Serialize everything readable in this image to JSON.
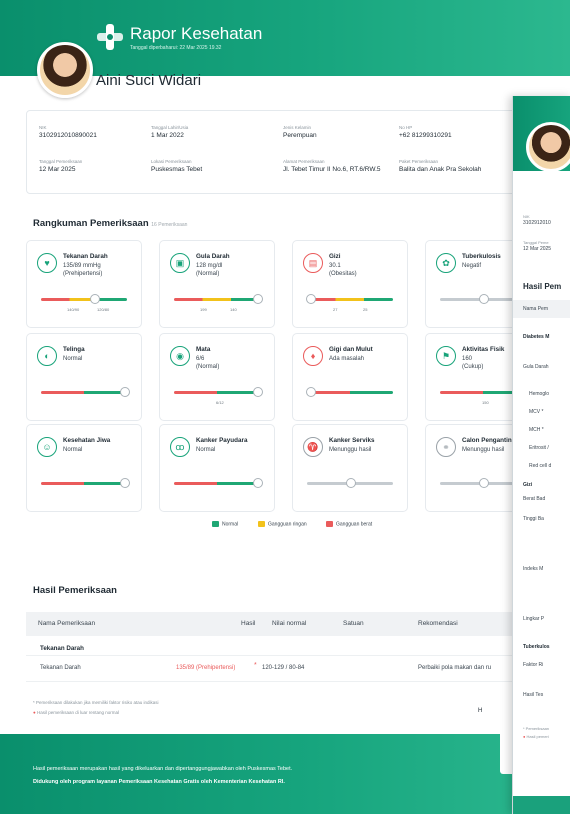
{
  "header": {
    "brand": "Rapor Kesehatan",
    "updated": "Tanggal diperbaharui: 22 Mar 2025 19.32"
  },
  "patient": {
    "name": "Aini Suci Widari"
  },
  "info": {
    "nik_label": "NIK",
    "nik": "3102912010890021",
    "dob_label": "Tanggal Lahir/Usia",
    "dob": "1 Mar 2022",
    "sex_label": "Jenis Kelamin",
    "sex": "Perempuan",
    "phone_label": "No HP",
    "phone": "+62 81299310291",
    "exam_date_label": "Tanggal Pemeriksaan",
    "exam_date": "12 Mar 2025",
    "location_label": "Lokasi Pemeriksaan",
    "location": "Puskesmas Tebet",
    "address_label": "Alamat Pemeriksaan",
    "address": "Jl. Tebet Timur II No.6, RT.6/RW.5",
    "package_label": "Paket Pemeriksaan",
    "package": "Balita dan Anak Pra Sekolah"
  },
  "summary": {
    "title": "Rangkuman Pemeriksaan",
    "count": "16 Pemeriksaan",
    "cards": [
      {
        "title": "Tekanan Darah",
        "l1": "135/89 mmHg",
        "l2": "(Prehipertensi)",
        "t1": "140/90",
        "t2": "120/80",
        "level": 0.62,
        "icon": "blood-pressure-icon",
        "glyph": "♥"
      },
      {
        "title": "Gula Darah",
        "l1": "128 mg/dl",
        "l2": "(Normal)",
        "t1": "199",
        "t2": "140",
        "level": 0.96,
        "icon": "glucose-meter-icon",
        "glyph": "▣"
      },
      {
        "title": "Gizi",
        "l1": "30.1",
        "l2": "(Obesitas)",
        "t1": "27",
        "t2": "25",
        "level": 0.03,
        "icon": "nutrition-icon",
        "glyph": "▤"
      },
      {
        "title": "Tuberkulosis",
        "l1": "Negatif",
        "l2": "",
        "t1": "",
        "t2": "",
        "level": 0.5,
        "icon": "lungs-icon",
        "glyph": "✿"
      },
      {
        "title": "Telinga",
        "l1": "Normal",
        "l2": "",
        "t1": "",
        "t2": "",
        "level": 0.96,
        "icon": "ear-icon",
        "glyph": "◐"
      },
      {
        "title": "Mata",
        "l1": "6/6",
        "l2": "(Normal)",
        "t1": "6/12",
        "t2": "",
        "level": 0.96,
        "icon": "eye-icon",
        "glyph": "◉"
      },
      {
        "title": "Gigi dan Mulut",
        "l1": "Ada masalah",
        "l2": "",
        "t1": "",
        "t2": "",
        "level": 0.03,
        "icon": "tooth-icon",
        "glyph": "♦"
      },
      {
        "title": "Aktivitas Fisik",
        "l1": "160",
        "l2": "(Cukup)",
        "t1": "150",
        "t2": "",
        "level": 0.96,
        "icon": "running-icon",
        "glyph": "⚑"
      },
      {
        "title": "Kesehatan Jiwa",
        "l1": "Normal",
        "l2": "",
        "t1": "",
        "t2": "",
        "level": 0.96,
        "icon": "mind-icon",
        "glyph": "☺"
      },
      {
        "title": "Kanker Payudara",
        "l1": "Normal",
        "l2": "",
        "t1": "",
        "t2": "",
        "level": 0.96,
        "icon": "ribbon-icon",
        "glyph": "ꝏ"
      },
      {
        "title": "Kanker Serviks",
        "l1": "Menunggu hasil",
        "l2": "",
        "t1": "",
        "t2": "",
        "level": 0.5,
        "icon": "uterus-icon",
        "glyph": "♈"
      },
      {
        "title": "Calon Pengantin",
        "l1": "Menunggu hasil",
        "l2": "",
        "t1": "",
        "t2": "",
        "level": 0.5,
        "icon": "rings-icon",
        "glyph": "⚭"
      }
    ],
    "legend": {
      "normal": "Normal",
      "mild": "Gangguan ringan",
      "severe": "Gangguan berat"
    }
  },
  "colors": {
    "green": "#1fa774",
    "yellow": "#f2c21b",
    "red": "#ea5b5b",
    "gray": "#c5cbd0"
  },
  "results": {
    "title": "Hasil Pemeriksaan",
    "columns": {
      "name": "Nama Pemeriksaan",
      "result": "Hasil",
      "normal": "Nilai normal",
      "unit": "Satuan",
      "rec": "Rekomendasi"
    },
    "group": "Tekanan Darah",
    "row": {
      "name": "Tekanan Darah",
      "result": "135/89 (Prehipertensi)",
      "mark": "*",
      "normal": "120-129 / 80-84",
      "unit": "",
      "rec": "Perbaiki pola makan dan ru"
    },
    "note1": "* Pemeriksaan dilakukan jika memiliki faktor risiko atau indikasi",
    "note2": "Hasil pemeriksaan di luar rentang normal",
    "cut": "H"
  },
  "footer": {
    "line1": "Hasil pemeriksaan merupakan hasil yang dikeluarkan dan dipertanggungjawabkan oleh Puskesmas Tebet.",
    "line2": "Didukung oleh program layanan Pemeriksaan Kesehatan Gratis oleh Kementerian Kesehatan RI."
  },
  "doc2": {
    "nik": "3102912010",
    "exam_label": "Tanggal Peme",
    "exam_date": "12 Mar 2025",
    "results_title": "Hasil Pem",
    "col_name": "Nama Pem",
    "rows": [
      "Diabetes M",
      "Gula Darah",
      "Hemoglo",
      "MCV *",
      "MCH *",
      "Eritrosit /",
      "Red cell d",
      "Gizi",
      "Berat Bad",
      "Tinggi Ba",
      "Indeks M",
      "Lingkar P",
      "Tuberkulos",
      "Faktor Ri",
      "Hasil Tes"
    ],
    "note1": "* Pemeriksaan",
    "note2": "Hasil pemeri"
  }
}
